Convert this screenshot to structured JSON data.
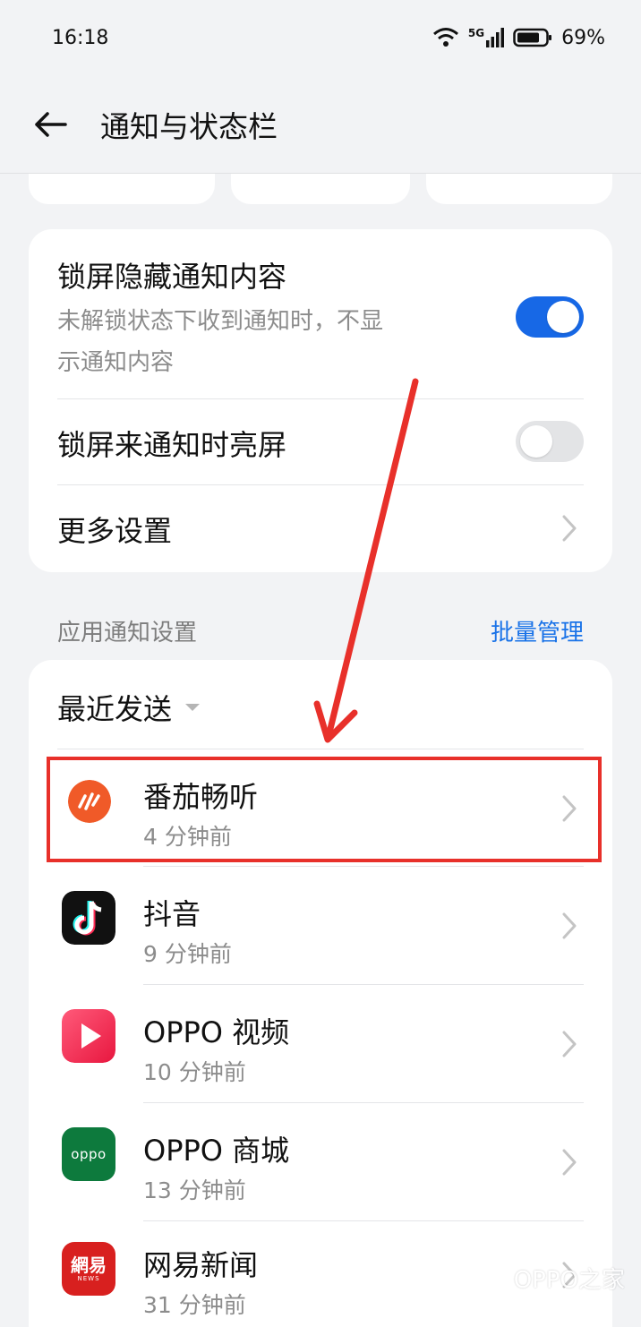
{
  "status_bar": {
    "time": "16:18",
    "network": "5G",
    "battery": "69%"
  },
  "header": {
    "title": "通知与状态栏"
  },
  "lock_settings": {
    "hide_content_title": "锁屏隐藏通知内容",
    "hide_content_desc_line1": "未解锁状态下收到通知时，不显",
    "hide_content_desc_line2": "示通知内容",
    "hide_content_enabled": true,
    "wake_title": "锁屏来通知时亮屏",
    "wake_enabled": false,
    "more_title": "更多设置"
  },
  "app_section": {
    "label": "应用通知设置",
    "batch_label": "批量管理",
    "sort_label": "最近发送",
    "apps": [
      {
        "name": "番茄畅听",
        "time": "4 分钟前",
        "icon": "fanqie-changting-icon",
        "color": "#f05a28"
      },
      {
        "name": "抖音",
        "time": "9 分钟前",
        "icon": "douyin-icon",
        "color": "#111111"
      },
      {
        "name": "OPPO 视频",
        "time": "10 分钟前",
        "icon": "oppo-video-icon",
        "color": "#f0325a"
      },
      {
        "name": "OPPO 商城",
        "time": "13 分钟前",
        "icon": "oppo-store-icon",
        "color": "#0d7a3d"
      },
      {
        "name": "网易新闻",
        "time": "31 分钟前",
        "icon": "netease-news-icon",
        "color": "#d8201f"
      }
    ]
  },
  "icon_text": {
    "oppo_store": "oppo",
    "netease": "網易",
    "netease_sub": "NEWS"
  },
  "watermark": {
    "text": "OPPO之家"
  }
}
